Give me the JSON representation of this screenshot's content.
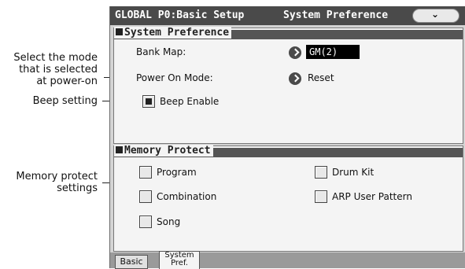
{
  "annotations": {
    "power_on_mode_note": "Select the mode that is selected at power-on",
    "beep_note": "Beep setting",
    "memory_protect_note": "Memory protect settings"
  },
  "titlebar": {
    "left": "GLOBAL P0:Basic Setup",
    "right": "System Preference",
    "menu_icon": "chevron-down-icon"
  },
  "system_preference": {
    "section_title": "System Preference",
    "bank_map_label": "Bank Map:",
    "bank_map_value": "GM(2)",
    "power_on_mode_label": "Power On Mode:",
    "power_on_mode_value": "Reset",
    "beep_enable_label": "Beep Enable",
    "beep_enable_checked": true
  },
  "memory_protect": {
    "section_title": "Memory Protect",
    "items": [
      {
        "label": "Program",
        "checked": false
      },
      {
        "label": "Drum Kit",
        "checked": false
      },
      {
        "label": "Combination",
        "checked": false
      },
      {
        "label": "ARP User Pattern",
        "checked": false
      },
      {
        "label": "Song",
        "checked": false
      }
    ]
  },
  "tabs": [
    {
      "label": "Basic",
      "active": false
    },
    {
      "label": "System Pref.",
      "active": true
    }
  ]
}
